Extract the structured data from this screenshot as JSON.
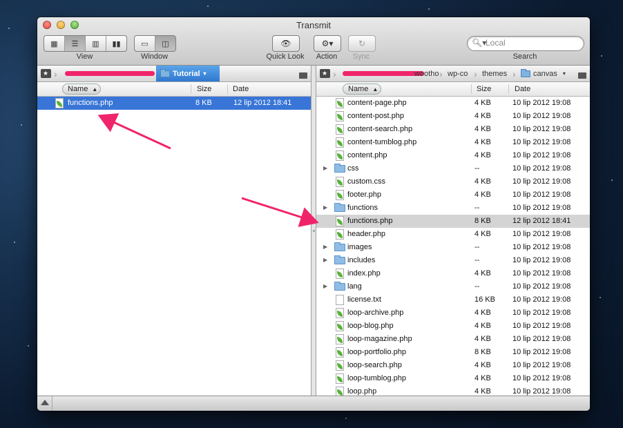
{
  "window": {
    "title": "Transmit"
  },
  "toolbar": {
    "view_label": "View",
    "window_label": "Window",
    "quicklook_label": "Quick Look",
    "action_label": "Action",
    "sync_label": "Sync",
    "search_label": "Search",
    "search_placeholder": "Local"
  },
  "left": {
    "path": [
      {
        "label": "Tutorial",
        "active": true
      }
    ],
    "columns": {
      "name": "Name",
      "size": "Size",
      "date": "Date"
    },
    "rows": [
      {
        "type": "php",
        "name": "functions.php",
        "size": "8 KB",
        "date": "12 lip 2012 18:41",
        "selected": "blue"
      }
    ]
  },
  "right": {
    "path": [
      {
        "label": "wootho"
      },
      {
        "label": "wp-co"
      },
      {
        "label": "themes"
      },
      {
        "label": "canvas",
        "active": true
      }
    ],
    "columns": {
      "name": "Name",
      "size": "Size",
      "date": "Date"
    },
    "rows": [
      {
        "type": "php",
        "name": "content-page.php",
        "size": "4 KB",
        "date": "10 lip 2012 19:08"
      },
      {
        "type": "php",
        "name": "content-post.php",
        "size": "4 KB",
        "date": "10 lip 2012 19:08"
      },
      {
        "type": "php",
        "name": "content-search.php",
        "size": "4 KB",
        "date": "10 lip 2012 19:08"
      },
      {
        "type": "php",
        "name": "content-tumblog.php",
        "size": "4 KB",
        "date": "10 lip 2012 19:08"
      },
      {
        "type": "php",
        "name": "content.php",
        "size": "4 KB",
        "date": "10 lip 2012 19:08"
      },
      {
        "type": "dir",
        "name": "css",
        "size": "--",
        "date": "10 lip 2012 19:08"
      },
      {
        "type": "php",
        "name": "custom.css",
        "size": "4 KB",
        "date": "10 lip 2012 19:08"
      },
      {
        "type": "php",
        "name": "footer.php",
        "size": "4 KB",
        "date": "10 lip 2012 19:08"
      },
      {
        "type": "dir",
        "name": "functions",
        "size": "--",
        "date": "10 lip 2012 19:08"
      },
      {
        "type": "php",
        "name": "functions.php",
        "size": "8 KB",
        "date": "12 lip 2012 18:41",
        "selected": "gray"
      },
      {
        "type": "php",
        "name": "header.php",
        "size": "4 KB",
        "date": "10 lip 2012 19:08"
      },
      {
        "type": "dir",
        "name": "images",
        "size": "--",
        "date": "10 lip 2012 19:08"
      },
      {
        "type": "dir",
        "name": "includes",
        "size": "--",
        "date": "10 lip 2012 19:08"
      },
      {
        "type": "php",
        "name": "index.php",
        "size": "4 KB",
        "date": "10 lip 2012 19:08"
      },
      {
        "type": "dir",
        "name": "lang",
        "size": "--",
        "date": "10 lip 2012 19:08"
      },
      {
        "type": "txt",
        "name": "license.txt",
        "size": "16 KB",
        "date": "10 lip 2012 19:08"
      },
      {
        "type": "php",
        "name": "loop-archive.php",
        "size": "4 KB",
        "date": "10 lip 2012 19:08"
      },
      {
        "type": "php",
        "name": "loop-blog.php",
        "size": "4 KB",
        "date": "10 lip 2012 19:08"
      },
      {
        "type": "php",
        "name": "loop-magazine.php",
        "size": "4 KB",
        "date": "10 lip 2012 19:08"
      },
      {
        "type": "php",
        "name": "loop-portfolio.php",
        "size": "8 KB",
        "date": "10 lip 2012 19:08"
      },
      {
        "type": "php",
        "name": "loop-search.php",
        "size": "4 KB",
        "date": "10 lip 2012 19:08"
      },
      {
        "type": "php",
        "name": "loop-tumblog.php",
        "size": "4 KB",
        "date": "10 lip 2012 19:08"
      },
      {
        "type": "php",
        "name": "loop.php",
        "size": "4 KB",
        "date": "10 lip 2012 19:08"
      }
    ]
  },
  "colors": {
    "annotation": "#f0246b",
    "selection": "#3875d7"
  }
}
